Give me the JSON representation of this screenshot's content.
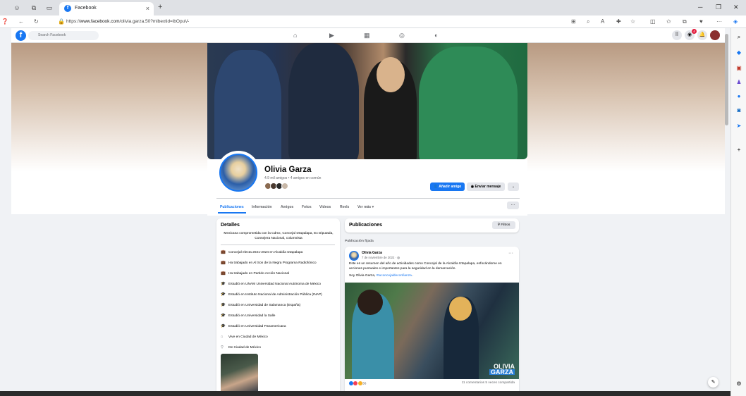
{
  "browser": {
    "tab_title": "Facebook",
    "url_prefix": "https://",
    "url_host": "www.facebook.com",
    "url_path": "/olivia.garza.50?mibextid=ibOpuV-",
    "new_tab": "+",
    "close_tab": "×"
  },
  "fb": {
    "logo": "f",
    "search_placeholder": "Search Facebook",
    "notif_badge": "4"
  },
  "profile": {
    "name": "Olivia Garza",
    "friends": "4.9 mil amigos • 4 amigos en común",
    "add_friend": "Añadir amigo",
    "send_message": "Enviar mensaje",
    "more": "⌄",
    "tabs": [
      "Publicaciones",
      "Información",
      "Amigos",
      "Fotos",
      "Videos",
      "Reels",
      "Ver más ▾"
    ],
    "tabs_more": "···"
  },
  "details": {
    "title": "Detalles",
    "bio": "Mexicana comprometida con la Cdmx, Concejal Iztapalapa, Ex Diputada, Consejera Nacional, columnista",
    "items": [
      {
        "icon": "briefcase-icon",
        "text": "Concejal electa 2021-2024 en Alcaldía Iztapalapa"
      },
      {
        "icon": "briefcase-icon",
        "text": "Ha trabajado en Al Son de la Negra Programa Radiofónico"
      },
      {
        "icon": "briefcase-icon",
        "text": "Ha trabajado en Partido Acción Nacional"
      },
      {
        "icon": "graduation-cap-icon",
        "text": "Estudió en UNAM Universidad Nacional Autónoma de México"
      },
      {
        "icon": "graduation-cap-icon",
        "text": "Estudió en Instituto Nacional de Administración Pública (INAP)"
      },
      {
        "icon": "graduation-cap-icon",
        "text": "Estudió en Universidad de Salamanca (España)"
      },
      {
        "icon": "graduation-cap-icon",
        "text": "Estudió en Universidad la Salle"
      },
      {
        "icon": "graduation-cap-icon",
        "text": "Estudió en Universidad Panamericana"
      },
      {
        "icon": "home-icon",
        "text": "Vive en Ciudad de México"
      },
      {
        "icon": "location-pin-icon",
        "text": "De Ciudad de México"
      }
    ]
  },
  "publications": {
    "title": "Publicaciones",
    "filters": "⚲ Filtros",
    "pinned": "Publicación fijada",
    "post": {
      "author": "Olivia Garza",
      "date": "7 de noviembre de 2022 · ◍",
      "text": "Este es un resumen del año de actividades como Concejal de la Alcaldía Iztapalapa, enfocándome en acciones puntuales e importantes para la seguridad en la demarcación.",
      "sign_prefix": "Soy Olivia Garza, ",
      "hashtag": "#tuconcejaldeconfianza",
      "sign_suffix": " .",
      "image_logo_line1": "OLIVIA",
      "image_logo_line2": "GARZA",
      "reaction_count": "36",
      "comments": "11 comentarios  5 veces compartida"
    }
  },
  "colors": {
    "fb_blue": "#1877f2",
    "page_bg": "#f0f2f5"
  }
}
